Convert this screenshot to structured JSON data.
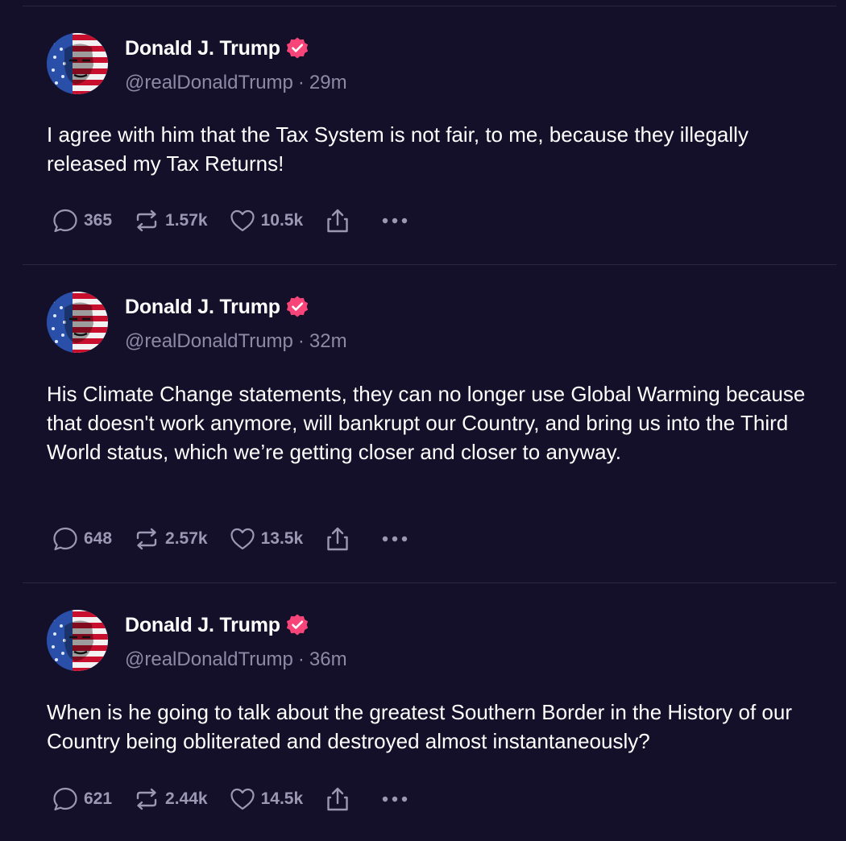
{
  "author": {
    "display_name": "Donald J. Trump",
    "handle": "@realDonaldTrump",
    "verified_color": "#f84579"
  },
  "posts": [
    {
      "time": "29m",
      "text": "I agree with him that the Tax System is not fair, to me, because they illegally released my Tax Returns!",
      "replies": "365",
      "reposts": "1.57k",
      "likes": "10.5k"
    },
    {
      "time": "32m",
      "text": "His Climate Change statements, they can no longer use Global Warming because that doesn't work anymore, will bankrupt our Country, and bring us into the Third World status, which we’re getting closer and closer to anyway.",
      "replies": "648",
      "reposts": "2.57k",
      "likes": "13.5k"
    },
    {
      "time": "36m",
      "text": "When is he going to talk about the greatest Southern Border in the History of our Country being obliterated and destroyed almost instantaneously?",
      "replies": "621",
      "reposts": "2.44k",
      "likes": "14.5k"
    }
  ],
  "separator": "·",
  "icons": {
    "reply": "speech-bubble-icon",
    "repost": "repost-arrows-icon",
    "like": "heart-icon",
    "share": "share-upload-icon",
    "more": "ellipsis-icon",
    "verified": "verified-badge-icon"
  }
}
